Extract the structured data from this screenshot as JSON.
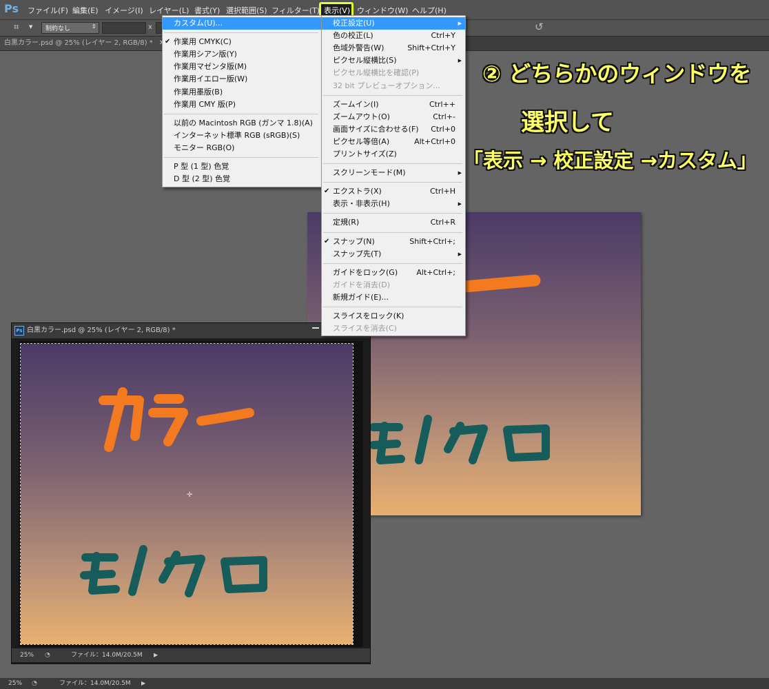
{
  "app": {
    "logo": "Ps"
  },
  "menubar": {
    "items": [
      "ファイル(F)",
      "編集(E)",
      "イメージ(I)",
      "レイヤー(L)",
      "書式(Y)",
      "選択範囲(S)",
      "フィルター(T)",
      "表示(V)",
      "ウィンドウ(W)",
      "ヘルプ(H)"
    ]
  },
  "options": {
    "preset": "制約なし",
    "x_label": "x"
  },
  "tab": {
    "title": "白黒カラー.psd @ 25% (レイヤー 2, RGB/8) *"
  },
  "view_menu": {
    "items": [
      {
        "label": "校正設定(U)",
        "shortcut": "",
        "submenu": true,
        "checked": false,
        "disabled": false,
        "highlighted": true
      },
      {
        "label": "色の校正(L)",
        "shortcut": "Ctrl+Y"
      },
      {
        "label": "色域外警告(W)",
        "shortcut": "Shift+Ctrl+Y"
      },
      {
        "label": "ピクセル縦横比(S)",
        "shortcut": "",
        "submenu": true
      },
      {
        "label": "ピクセル縦横比を確認(P)",
        "shortcut": "",
        "disabled": true
      },
      {
        "label": "32 bit プレビューオプション...",
        "shortcut": "",
        "disabled": true
      },
      {
        "sep": true
      },
      {
        "label": "ズームイン(I)",
        "shortcut": "Ctrl++"
      },
      {
        "label": "ズームアウト(O)",
        "shortcut": "Ctrl+-"
      },
      {
        "label": "画面サイズに合わせる(F)",
        "shortcut": "Ctrl+0"
      },
      {
        "label": "ピクセル等倍(A)",
        "shortcut": "Alt+Ctrl+0"
      },
      {
        "label": "プリントサイズ(Z)",
        "shortcut": ""
      },
      {
        "sep": true
      },
      {
        "label": "スクリーンモード(M)",
        "shortcut": "",
        "submenu": true
      },
      {
        "sep": true
      },
      {
        "label": "エクストラ(X)",
        "shortcut": "Ctrl+H",
        "checked": true
      },
      {
        "label": "表示・非表示(H)",
        "shortcut": "",
        "submenu": true
      },
      {
        "sep": true
      },
      {
        "label": "定規(R)",
        "shortcut": "Ctrl+R"
      },
      {
        "sep": true
      },
      {
        "label": "スナップ(N)",
        "shortcut": "Shift+Ctrl+;",
        "checked": true
      },
      {
        "label": "スナップ先(T)",
        "shortcut": "",
        "submenu": true
      },
      {
        "sep": true
      },
      {
        "label": "ガイドをロック(G)",
        "shortcut": "Alt+Ctrl+;"
      },
      {
        "label": "ガイドを消去(D)",
        "shortcut": "",
        "disabled": true
      },
      {
        "label": "新規ガイド(E)...",
        "shortcut": ""
      },
      {
        "sep": true
      },
      {
        "label": "スライスをロック(K)",
        "shortcut": ""
      },
      {
        "label": "スライスを消去(C)",
        "shortcut": "",
        "disabled": true
      }
    ]
  },
  "proof_submenu": {
    "items": [
      {
        "label": "カスタム(U)...",
        "highlighted": true
      },
      {
        "sep": true
      },
      {
        "label": "作業用 CMYK(C)",
        "checked": true
      },
      {
        "label": "作業用シアン版(Y)"
      },
      {
        "label": "作業用マゼンタ版(M)"
      },
      {
        "label": "作業用イエロー版(W)"
      },
      {
        "label": "作業用墨版(B)"
      },
      {
        "label": "作業用 CMY 版(P)"
      },
      {
        "sep": true
      },
      {
        "label": "以前の Macintosh RGB (ガンマ 1.8)(A)"
      },
      {
        "label": "インターネット標準 RGB (sRGB)(S)"
      },
      {
        "label": "モニター RGB(O)"
      },
      {
        "sep": true
      },
      {
        "label": "P 型 (1 型) 色覚"
      },
      {
        "label": "D 型 (2 型) 色覚"
      }
    ]
  },
  "annotation": {
    "line1": "② どちらかのウィンドウを",
    "line2": "選択して",
    "line3": "「表示 → 校正設定 →カスタム」"
  },
  "canvas": {
    "word_color": "カラー",
    "word_mono": "モノクロ",
    "orange": "#f47a1f",
    "teal": "#155c5a"
  },
  "status": {
    "zoom": "25%",
    "file": "ファイル：14.0M/20.5M"
  }
}
